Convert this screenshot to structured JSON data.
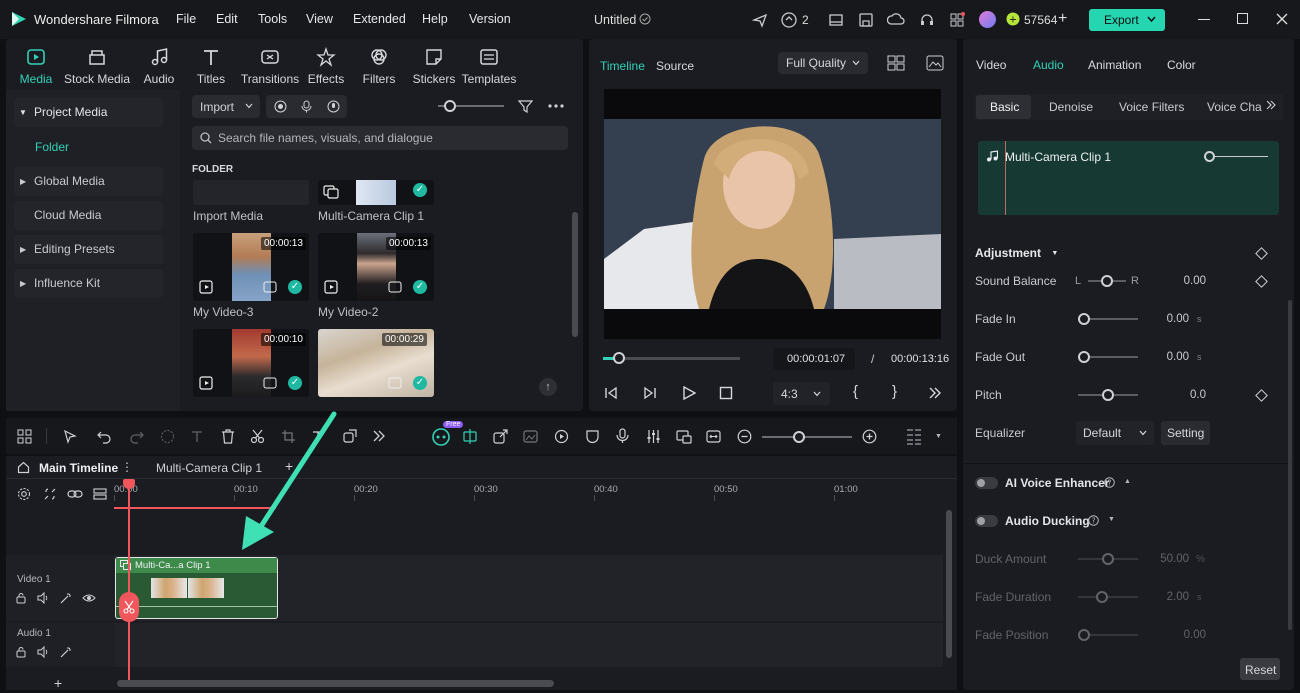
{
  "app": {
    "name": "Wondershare Filmora",
    "project_title": "Untitled",
    "credits": "57564",
    "export_label": "Export",
    "notifications": "2"
  },
  "menu": [
    "File",
    "Edit",
    "Tools",
    "View",
    "Extended",
    "Help",
    "Version"
  ],
  "toolbar": [
    "Media",
    "Stock Media",
    "Audio",
    "Titles",
    "Transitions",
    "Effects",
    "Filters",
    "Stickers",
    "Templates"
  ],
  "sidebar": {
    "items": [
      {
        "label": "Project Media"
      },
      {
        "label": "Folder"
      },
      {
        "label": "Global Media"
      },
      {
        "label": "Cloud Media"
      },
      {
        "label": "Editing Presets"
      },
      {
        "label": "Influence Kit"
      }
    ]
  },
  "media": {
    "import_label": "Import",
    "search_placeholder": "Search file names, visuals, and dialogue",
    "section": "FOLDER",
    "items": [
      {
        "name": "Import Media",
        "duration": ""
      },
      {
        "name": "Multi-Camera Clip 1",
        "duration": ""
      },
      {
        "name": "My Video-3",
        "duration": "00:00:13"
      },
      {
        "name": "My Video-2",
        "duration": "00:00:13"
      },
      {
        "name": "",
        "duration": "00:00:10"
      },
      {
        "name": "",
        "duration": "00:00:29"
      }
    ]
  },
  "player": {
    "tab_timeline": "Timeline",
    "tab_source": "Source",
    "quality": "Full Quality",
    "current_time": "00:00:01:07",
    "separator": "/",
    "total_time": "00:00:13:16",
    "aspect": "4:3",
    "progress": 0.12
  },
  "right_panel": {
    "tabs": [
      "Video",
      "Audio",
      "Animation",
      "Color"
    ],
    "active_tab": "Audio",
    "subtabs": [
      "Basic",
      "Denoise",
      "Voice Filters",
      "Voice Cha"
    ],
    "clip_name": "Multi-Camera Clip 1",
    "adjustment_label": "Adjustment",
    "sound_balance": {
      "label": "Sound Balance",
      "left": "L",
      "right": "R",
      "value": "0.00"
    },
    "fade_in": {
      "label": "Fade In",
      "value": "0.00",
      "unit": "s"
    },
    "fade_out": {
      "label": "Fade Out",
      "value": "0.00",
      "unit": "s"
    },
    "pitch": {
      "label": "Pitch",
      "value": "0.0"
    },
    "equalizer": {
      "label": "Equalizer",
      "value": "Default",
      "setting": "Setting"
    },
    "ai_voice": "AI Voice Enhancer",
    "audio_ducking": "Audio Ducking",
    "duck_amount": {
      "label": "Duck Amount",
      "value": "50.00",
      "unit": "%"
    },
    "fade_duration": {
      "label": "Fade Duration",
      "value": "2.00",
      "unit": "s"
    },
    "fade_position": {
      "label": "Fade Position",
      "value": "0.00"
    },
    "reset": "Reset"
  },
  "timeline": {
    "tab_main": "Main Timeline",
    "tab_clip": "Multi-Camera Clip 1",
    "ruler": [
      "00:00",
      "00:10",
      "00:20",
      "00:30",
      "00:40",
      "00:50",
      "01:00"
    ],
    "tracks": [
      {
        "name": "Video 1"
      },
      {
        "name": "Audio 1"
      }
    ],
    "clip_label": "Multi-Ca...a Clip 1",
    "free_badge": "Free"
  },
  "colors": {
    "accent": "#33d1b7",
    "playhead": "#f0565b",
    "clip_green": "#2e6b3c",
    "export": "#26d6b0"
  }
}
